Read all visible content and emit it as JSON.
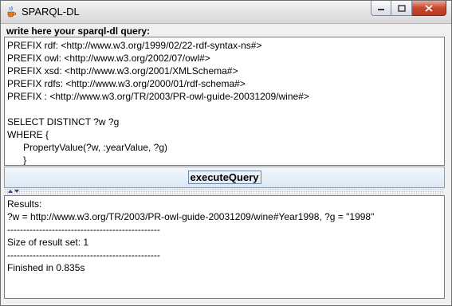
{
  "window": {
    "title": "SPARQL-DL",
    "icon": "java-cup-icon",
    "controls": [
      "minimize-icon",
      "maximize-icon",
      "close-icon"
    ]
  },
  "query_panel": {
    "label": "write here your sparql-dl query:",
    "lines": [
      "PREFIX rdf: <http://www.w3.org/1999/02/22-rdf-syntax-ns#>",
      "PREFIX owl: <http://www.w3.org/2002/07/owl#>",
      "PREFIX xsd: <http://www.w3.org/2001/XMLSchema#>",
      "PREFIX rdfs: <http://www.w3.org/2000/01/rdf-schema#>",
      "PREFIX : <http://www.w3.org/TR/2003/PR-owl-guide-20031209/wine#>",
      "",
      "SELECT DISTINCT ?w ?g",
      "WHERE {",
      "      PropertyValue(?w, :yearValue, ?g)",
      "      }"
    ]
  },
  "execute_button": {
    "label": "executeQuery"
  },
  "results_panel": {
    "lines": [
      "Results:",
      "?w = http://www.w3.org/TR/2003/PR-owl-guide-20031209/wine#Year1998, ?g = \"1998\"",
      "------------------------------------------------",
      "Size of result set: 1",
      "------------------------------------------------",
      "Finished in 0.835s"
    ]
  }
}
